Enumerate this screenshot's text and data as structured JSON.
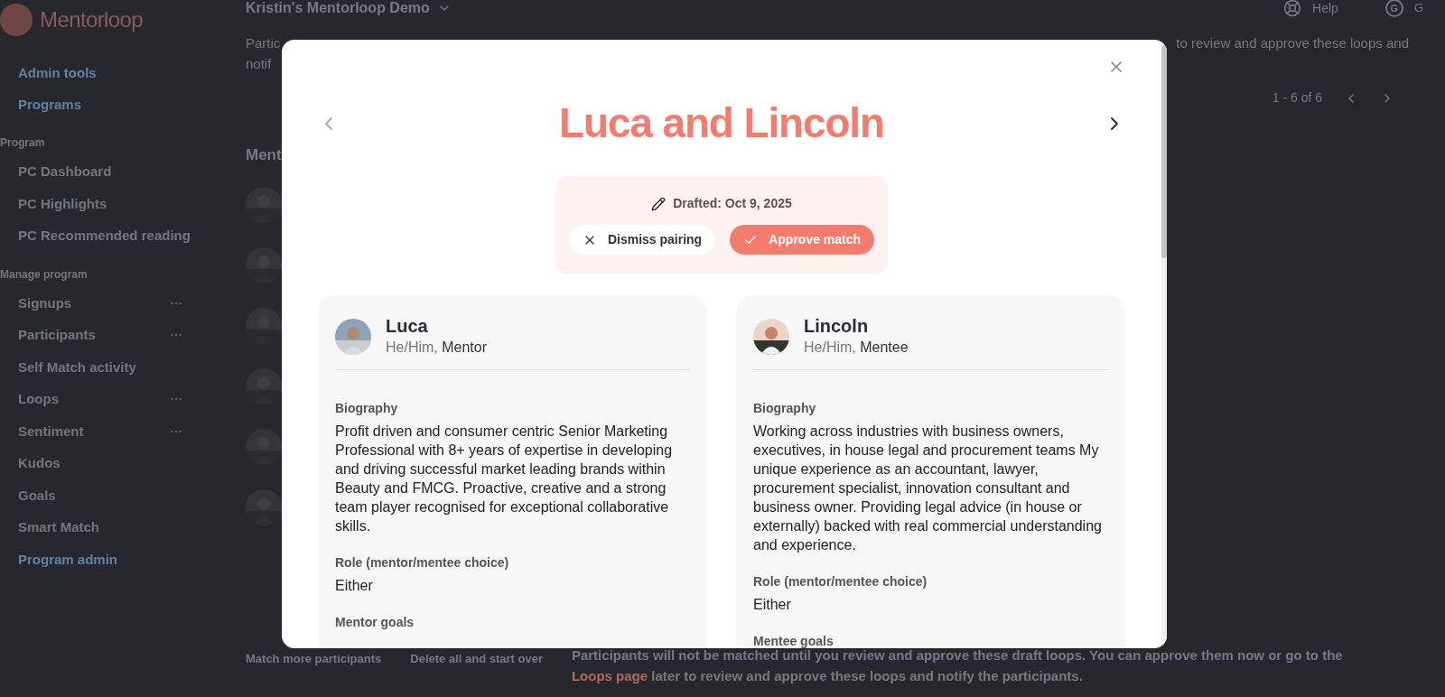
{
  "sidebar": {
    "logo": "Mentorloop",
    "top_items": [
      {
        "label": "Admin tools"
      },
      {
        "label": "Programs"
      }
    ],
    "sections": [
      {
        "title": "Program",
        "items": [
          {
            "label": "PC Dashboard",
            "menu": false
          },
          {
            "label": "PC Highlights",
            "menu": false
          },
          {
            "label": "PC Recommended reading",
            "menu": false
          }
        ]
      },
      {
        "title": "Manage program",
        "items": [
          {
            "label": "Signups",
            "menu": true
          },
          {
            "label": "Participants",
            "menu": true
          },
          {
            "label": "Self Match activity",
            "menu": false
          },
          {
            "label": "Loops",
            "menu": true
          },
          {
            "label": "Sentiment",
            "menu": true
          },
          {
            "label": "Kudos",
            "menu": false
          },
          {
            "label": "Goals",
            "menu": false
          },
          {
            "label": "Smart Match",
            "menu": false
          }
        ]
      }
    ],
    "bottom_item": "Program admin"
  },
  "header": {
    "title": "Kristin's Mentorloop Demo",
    "help": "Help",
    "user_initial": "G",
    "user_name": "G"
  },
  "intro": {
    "left_lines": [
      "Partic",
      "notif"
    ],
    "right_line": "to review and approve these loops and"
  },
  "pagination": "1 - 6 of 6",
  "list_heading": "Ment",
  "footer": {
    "buttons": [
      "Match more participants",
      "Delete all and start over"
    ],
    "text_before": "Participants will not be matched until you review and approve these draft loops. You can approve them now or go to the",
    "link": "Loops page",
    "text_after": "later to review and approve these loops and notify the participants."
  },
  "modal": {
    "title": "Luca and Lincoln",
    "drafted": "Drafted: Oct 9, 2025",
    "dismiss": "Dismiss pairing",
    "approve": "Approve match",
    "people": [
      {
        "name": "Luca",
        "pronouns": "He/Him,",
        "role": "Mentor",
        "fields": [
          {
            "label": "Biography",
            "value": "Profit driven and consumer centric Senior Marketing Professional with 8+ years of expertise in developing and driving successful market leading brands within Beauty and FMCG. Proactive, creative and a strong team player recognised for exceptional collaborative skills."
          },
          {
            "label": "Role (mentor/mentee choice)",
            "value": "Either"
          },
          {
            "label": "Mentor goals"
          }
        ]
      },
      {
        "name": "Lincoln",
        "pronouns": "He/Him,",
        "role": "Mentee",
        "fields": [
          {
            "label": "Biography",
            "value": "Working across industries with business owners, executives, in house legal and procurement teams My unique experience as an accountant, lawyer, procurement specialist, innovation consultant and business owner. Providing legal advice (in house or externally) backed with real commercial understanding and experience."
          },
          {
            "label": "Role (mentor/mentee choice)",
            "value": "Either"
          },
          {
            "label": "Mentee goals"
          }
        ]
      }
    ]
  }
}
